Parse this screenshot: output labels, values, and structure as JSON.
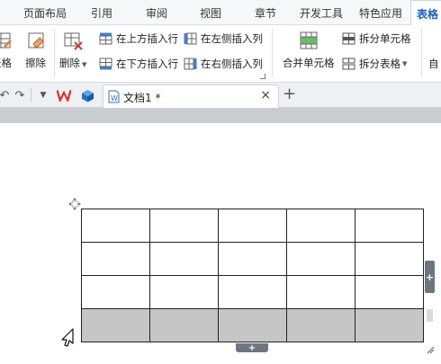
{
  "menu": {
    "tabs": [
      "页面布局",
      "引用",
      "审阅",
      "视图",
      "章节",
      "开发工具",
      "特色应用",
      "表格"
    ],
    "active_tab": "表格"
  },
  "ribbon": {
    "draw_table": "表格",
    "erase": "擦除",
    "delete": "删除",
    "insert_row_above": "在上方插入行",
    "insert_row_below": "在下方插入行",
    "insert_col_left": "在左侧插入列",
    "insert_col_right": "在右侧插入列",
    "merge_cells": "合并单元格",
    "split_cells": "拆分单元格",
    "split_table": "拆分表格",
    "auto_fit": "自"
  },
  "tabbar": {
    "doc_title": "文档1 *",
    "close": "×",
    "new_tab": "+"
  },
  "table": {
    "rows": 4,
    "cols": 5,
    "shaded_row_index": 3
  },
  "handles": {
    "add_row": "+",
    "add_col": "+"
  },
  "colors": {
    "accent": "#1f5fbf",
    "shaded_cell": "#c6c6c6",
    "ribbon_bg": "#ffffff",
    "grey_band": "#c9ccd1"
  }
}
